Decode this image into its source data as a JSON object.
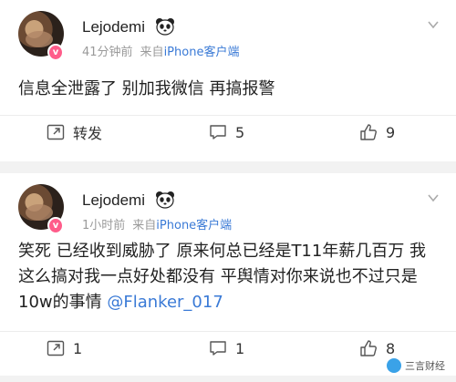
{
  "posts": [
    {
      "username": "Lejodemi",
      "time": "41分钟前",
      "source_prefix": "来自",
      "device": "iPhone客户端",
      "content": "信息全泄露了 别加我微信 再搞报警",
      "repost_label": "转发",
      "comment_count": "5",
      "like_count": "9"
    },
    {
      "username": "Lejodemi",
      "time": "1小时前",
      "source_prefix": "来自",
      "device": "iPhone客户端",
      "content": "笑死 已经收到威胁了 原来何总已经是T11年薪几百万 我这么搞对我一点好处都没有 平舆情对你来说也不过只是10w的事情",
      "mention": "@Flanker_017",
      "repost_count": "1",
      "comment_count": "1",
      "like_count": "8"
    }
  ],
  "watermark": "三言财经",
  "colors": {
    "link": "#3a7ad6",
    "meta": "#9a9a9a",
    "badge": "#ff5c8a"
  },
  "icons": [
    "panda-icon",
    "chevron-down-icon",
    "repost-icon",
    "comment-icon",
    "like-icon",
    "verified-badge-icon"
  ]
}
